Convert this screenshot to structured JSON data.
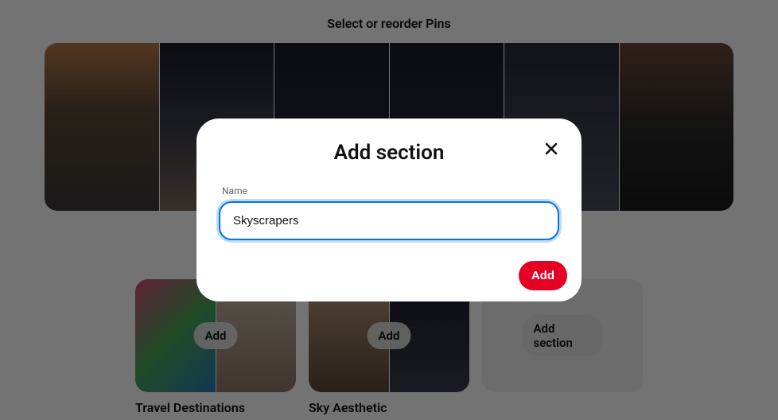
{
  "header": {
    "title": "Select or reorder Pins"
  },
  "sections": {
    "add_pill": "Add",
    "add_section_pill": "Add section",
    "items": [
      {
        "title": "Travel Destinations"
      },
      {
        "title": "Sky Aesthetic"
      }
    ]
  },
  "modal": {
    "title": "Add section",
    "name_label": "Name",
    "name_value": "Skyscrapers",
    "add_button": "Add"
  }
}
